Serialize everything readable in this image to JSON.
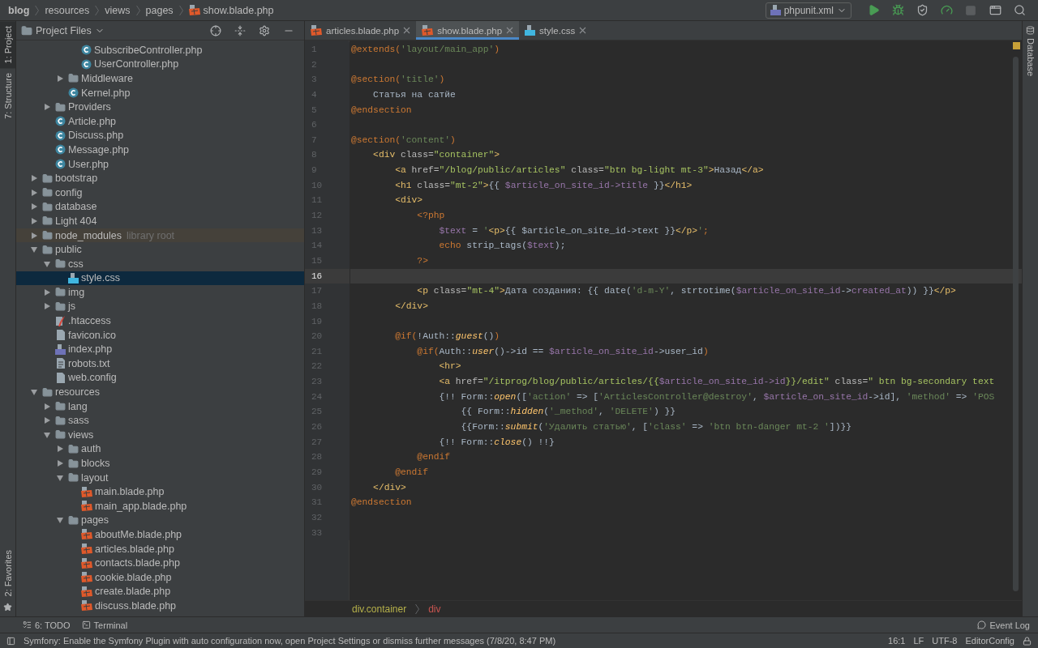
{
  "nav_bar": {
    "breadcrumbs": [
      "blog",
      "resources",
      "views",
      "pages",
      "show.blade.php"
    ],
    "run_config": {
      "label": "phpunit.xml"
    }
  },
  "left_tool_strip": [
    {
      "label": "1: Project",
      "selected": true
    },
    {
      "label": "7: Structure",
      "selected": false
    }
  ],
  "favorites": {
    "label": "2: Favorites"
  },
  "project_panel": {
    "title": "Project Files",
    "items": [
      {
        "kind": "offscreen",
        "children": [
          {
            "kind": "offscreen",
            "children": [
              {
                "kind": "offscreen",
                "children": [
                  {
                    "kind": "class",
                    "label": "SubscribeController.php",
                    "selected": false
                  },
                  {
                    "kind": "class",
                    "label": "UserController.php",
                    "selected": false
                  }
                ]
              },
              {
                "kind": "folder",
                "label": "Middleware",
                "expanded": false,
                "selected": false
              },
              {
                "kind": "class",
                "label": "Kernel.php",
                "selected": false
              }
            ]
          },
          {
            "kind": "folder",
            "label": "Providers",
            "expanded": false,
            "selected": false
          },
          {
            "kind": "class",
            "label": "Article.php",
            "selected": false
          },
          {
            "kind": "class",
            "label": "Discuss.php",
            "selected": false
          },
          {
            "kind": "class",
            "label": "Message.php",
            "selected": false
          },
          {
            "kind": "class",
            "label": "User.php",
            "selected": false
          }
        ]
      },
      {
        "kind": "folder",
        "label": "bootstrap",
        "expanded": false,
        "selected": false
      },
      {
        "kind": "folder",
        "label": "config",
        "expanded": false,
        "selected": false
      },
      {
        "kind": "folder",
        "label": "database",
        "expanded": false,
        "selected": false
      },
      {
        "kind": "folder",
        "label": "Light 404",
        "expanded": false,
        "selected": false
      },
      {
        "kind": "folder",
        "label": "node_modules",
        "note": "library root",
        "expanded": false,
        "selected": false
      },
      {
        "kind": "folder",
        "label": "public",
        "expanded": true,
        "selected": false,
        "children": [
          {
            "kind": "folder",
            "label": "css",
            "expanded": true,
            "selected": false,
            "children": [
              {
                "kind": "css",
                "label": "style.css",
                "selected": true
              }
            ]
          },
          {
            "kind": "folder",
            "label": "img",
            "expanded": false,
            "selected": false
          },
          {
            "kind": "folder",
            "label": "js",
            "expanded": false,
            "selected": false
          },
          {
            "kind": "htaccess",
            "label": ".htaccess",
            "selected": false
          },
          {
            "kind": "generic",
            "label": "favicon.ico",
            "selected": false
          },
          {
            "kind": "php",
            "label": "index.php",
            "selected": false
          },
          {
            "kind": "text",
            "label": "robots.txt",
            "selected": false
          },
          {
            "kind": "generic",
            "label": "web.config",
            "selected": false
          }
        ]
      },
      {
        "kind": "folder",
        "label": "resources",
        "expanded": true,
        "selected": false,
        "children": [
          {
            "kind": "folder",
            "label": "lang",
            "expanded": false,
            "selected": false
          },
          {
            "kind": "folder",
            "label": "sass",
            "expanded": false,
            "selected": false
          },
          {
            "kind": "folder",
            "label": "views",
            "expanded": true,
            "selected": false,
            "children": [
              {
                "kind": "folder",
                "label": "auth",
                "expanded": false,
                "selected": false
              },
              {
                "kind": "folder",
                "label": "blocks",
                "expanded": false,
                "selected": false
              },
              {
                "kind": "folder",
                "label": "layout",
                "expanded": true,
                "selected": false,
                "children": [
                  {
                    "kind": "blade",
                    "label": "main.blade.php",
                    "selected": false
                  },
                  {
                    "kind": "blade",
                    "label": "main_app.blade.php",
                    "selected": false
                  }
                ]
              },
              {
                "kind": "folder",
                "label": "pages",
                "expanded": true,
                "selected": false,
                "children": [
                  {
                    "kind": "blade",
                    "label": "aboutMe.blade.php",
                    "selected": false
                  },
                  {
                    "kind": "blade",
                    "label": "articles.blade.php",
                    "selected": false
                  },
                  {
                    "kind": "blade",
                    "label": "contacts.blade.php",
                    "selected": false
                  },
                  {
                    "kind": "blade",
                    "label": "cookie.blade.php",
                    "selected": false
                  },
                  {
                    "kind": "blade",
                    "label": "create.blade.php",
                    "selected": false
                  },
                  {
                    "kind": "blade",
                    "label": "discuss.blade.php",
                    "selected": false
                  }
                ]
              }
            ]
          }
        ]
      }
    ]
  },
  "tabs": [
    {
      "label": "articles.blade.php",
      "kind": "blade",
      "selected": false
    },
    {
      "label": "show.blade.php",
      "kind": "blade",
      "selected": true
    },
    {
      "label": "style.css",
      "kind": "css",
      "selected": false
    }
  ],
  "editor": {
    "lines": [
      {
        "number": "1",
        "current": false,
        "tokens": [
          {
            "kind": "directive",
            "text": "@extends("
          },
          {
            "kind": "string",
            "text": "'layout/main_app'"
          },
          {
            "kind": "directive",
            "text": ")"
          }
        ]
      },
      {
        "number": "2",
        "current": false
      },
      {
        "number": "3",
        "current": false,
        "tokens": [
          {
            "kind": "directive",
            "text": "@section("
          },
          {
            "kind": "string",
            "text": "'title'"
          },
          {
            "kind": "directive",
            "text": ")"
          }
        ]
      },
      {
        "number": "4",
        "current": false,
        "tokens": [
          {
            "kind": "plain",
            "text": "    Статья на сатйе"
          }
        ]
      },
      {
        "number": "5",
        "current": false,
        "tokens": [
          {
            "kind": "directive",
            "text": "@endsection"
          }
        ]
      },
      {
        "number": "6",
        "current": false
      },
      {
        "number": "7",
        "current": false,
        "tokens": [
          {
            "kind": "directive",
            "text": "@section("
          },
          {
            "kind": "string",
            "text": "'content'"
          },
          {
            "kind": "directive",
            "text": ")"
          }
        ]
      },
      {
        "number": "8",
        "current": false,
        "tokens": [
          {
            "kind": "tag",
            "text": "    <div"
          },
          {
            "kind": "attr",
            "text": " class="
          },
          {
            "kind": "value",
            "text": "\"container\""
          },
          {
            "kind": "tag",
            "text": ">"
          }
        ]
      },
      {
        "number": "9",
        "current": false,
        "tokens": [
          {
            "kind": "tag",
            "text": "        <a"
          },
          {
            "kind": "attr",
            "text": " href="
          },
          {
            "kind": "value",
            "text": "\"/blog/public/articles\""
          },
          {
            "kind": "attr",
            "text": " class="
          },
          {
            "kind": "value",
            "text": "\"btn bg-light mt-3\""
          },
          {
            "kind": "tag",
            "text": ">"
          },
          {
            "kind": "plain",
            "text": "Назад"
          },
          {
            "kind": "tag",
            "text": "</a>"
          }
        ]
      },
      {
        "number": "10",
        "current": false,
        "tokens": [
          {
            "kind": "tag",
            "text": "        <h1"
          },
          {
            "kind": "attr",
            "text": " class="
          },
          {
            "kind": "value",
            "text": "\"mt-2\""
          },
          {
            "kind": "tag",
            "text": ">"
          },
          {
            "kind": "plain",
            "text": "{{ "
          },
          {
            "kind": "var",
            "text": "$article_on_site_id->title"
          },
          {
            "kind": "plain",
            "text": " }}"
          },
          {
            "kind": "tag",
            "text": "</h1>"
          }
        ]
      },
      {
        "number": "11",
        "current": false,
        "tokens": [
          {
            "kind": "tag",
            "text": "        <div>"
          }
        ]
      },
      {
        "number": "12",
        "current": false,
        "tokens": [
          {
            "kind": "keyword",
            "text": "            <?php"
          }
        ]
      },
      {
        "number": "13",
        "current": false,
        "tokens": [
          {
            "kind": "var",
            "text": "                $text"
          },
          {
            "kind": "plain",
            "text": " = "
          },
          {
            "kind": "string",
            "text": "'"
          },
          {
            "kind": "tag",
            "text": "<p>"
          },
          {
            "kind": "plain",
            "text": "{{ $article_on_site_id->text }}"
          },
          {
            "kind": "tag",
            "text": "</p>"
          },
          {
            "kind": "string",
            "text": "'"
          },
          {
            "kind": "keyword",
            "text": ";"
          }
        ]
      },
      {
        "number": "14",
        "current": false,
        "tokens": [
          {
            "kind": "keyword",
            "text": "                echo"
          },
          {
            "kind": "plain",
            "text": " strip_tags("
          },
          {
            "kind": "var",
            "text": "$text"
          },
          {
            "kind": "plain",
            "text": ");"
          }
        ]
      },
      {
        "number": "15",
        "current": false,
        "tokens": [
          {
            "kind": "keyword",
            "text": "            ?>"
          }
        ]
      },
      {
        "number": "16",
        "current": true
      },
      {
        "number": "17",
        "current": false,
        "tokens": [
          {
            "kind": "tag",
            "text": "            <p"
          },
          {
            "kind": "attr",
            "text": " class="
          },
          {
            "kind": "value",
            "text": "\"mt-4\""
          },
          {
            "kind": "tag",
            "text": ">"
          },
          {
            "kind": "plain",
            "text": "Дата создания: {{ date("
          },
          {
            "kind": "string",
            "text": "'d-m-Y'"
          },
          {
            "kind": "plain",
            "text": ", strtotime("
          },
          {
            "kind": "var",
            "text": "$article_on_site_id"
          },
          {
            "kind": "plain",
            "text": "->"
          },
          {
            "kind": "var",
            "text": "created_at"
          },
          {
            "kind": "plain",
            "text": ")) }}"
          },
          {
            "kind": "tag",
            "text": "</p>"
          }
        ]
      },
      {
        "number": "18",
        "current": false,
        "tokens": [
          {
            "kind": "tag",
            "text": "        </div>"
          }
        ]
      },
      {
        "number": "19",
        "current": false
      },
      {
        "number": "20",
        "current": false,
        "tokens": [
          {
            "kind": "directive",
            "text": "        @if("
          },
          {
            "kind": "plain",
            "text": "!Auth::"
          },
          {
            "kind": "call",
            "text": "guest"
          },
          {
            "kind": "plain",
            "text": "()"
          },
          {
            "kind": "directive",
            "text": ")"
          }
        ]
      },
      {
        "number": "21",
        "current": false,
        "tokens": [
          {
            "kind": "directive",
            "text": "            @if("
          },
          {
            "kind": "plain",
            "text": "Auth::"
          },
          {
            "kind": "call",
            "text": "user"
          },
          {
            "kind": "plain",
            "text": "()->id == "
          },
          {
            "kind": "var",
            "text": "$article_on_site_id"
          },
          {
            "kind": "plain",
            "text": "->user_id"
          },
          {
            "kind": "directive",
            "text": ")"
          }
        ]
      },
      {
        "number": "22",
        "current": false,
        "tokens": [
          {
            "kind": "tag",
            "text": "                <hr>"
          }
        ]
      },
      {
        "number": "23",
        "current": false,
        "tokens": [
          {
            "kind": "tag",
            "text": "                <a"
          },
          {
            "kind": "attr",
            "text": " href="
          },
          {
            "kind": "value",
            "text": "\"/itprog/blog/public/articles/{{"
          },
          {
            "kind": "var",
            "text": "$article_on_site_id->id"
          },
          {
            "kind": "value",
            "text": "}}/edit\""
          },
          {
            "kind": "attr",
            "text": " class="
          },
          {
            "kind": "value",
            "text": "\" btn bg-secondary text"
          }
        ]
      },
      {
        "number": "24",
        "current": false,
        "tokens": [
          {
            "kind": "plain",
            "text": "                {!! Form::"
          },
          {
            "kind": "call",
            "text": "open"
          },
          {
            "kind": "plain",
            "text": "(["
          },
          {
            "kind": "string",
            "text": "'action'"
          },
          {
            "kind": "plain",
            "text": " => ["
          },
          {
            "kind": "string",
            "text": "'ArticlesController@destroy'"
          },
          {
            "kind": "plain",
            "text": ", "
          },
          {
            "kind": "var",
            "text": "$article_on_site_id"
          },
          {
            "kind": "plain",
            "text": "->id], "
          },
          {
            "kind": "string",
            "text": "'method'"
          },
          {
            "kind": "plain",
            "text": " => "
          },
          {
            "kind": "string",
            "text": "'POS"
          }
        ]
      },
      {
        "number": "25",
        "current": false,
        "tokens": [
          {
            "kind": "plain",
            "text": "                    {{ Form::"
          },
          {
            "kind": "call",
            "text": "hidden"
          },
          {
            "kind": "plain",
            "text": "("
          },
          {
            "kind": "string",
            "text": "'_method'"
          },
          {
            "kind": "plain",
            "text": ", "
          },
          {
            "kind": "string",
            "text": "'DELETE'"
          },
          {
            "kind": "plain",
            "text": ") }}"
          }
        ]
      },
      {
        "number": "26",
        "current": false,
        "tokens": [
          {
            "kind": "plain",
            "text": "                    {{Form::"
          },
          {
            "kind": "call",
            "text": "submit"
          },
          {
            "kind": "plain",
            "text": "("
          },
          {
            "kind": "string",
            "text": "'Удалить статью'"
          },
          {
            "kind": "plain",
            "text": ", ["
          },
          {
            "kind": "string",
            "text": "'class'"
          },
          {
            "kind": "plain",
            "text": " => "
          },
          {
            "kind": "string",
            "text": "'btn btn-danger mt-2 '"
          },
          {
            "kind": "plain",
            "text": "])}}"
          }
        ]
      },
      {
        "number": "27",
        "current": false,
        "tokens": [
          {
            "kind": "plain",
            "text": "                {!! Form::"
          },
          {
            "kind": "call",
            "text": "close"
          },
          {
            "kind": "plain",
            "text": "() !!}"
          }
        ]
      },
      {
        "number": "28",
        "current": false,
        "tokens": [
          {
            "kind": "directive",
            "text": "            @endif"
          }
        ]
      },
      {
        "number": "29",
        "current": false,
        "tokens": [
          {
            "kind": "directive",
            "text": "        @endif"
          }
        ]
      },
      {
        "number": "30",
        "current": false,
        "tokens": [
          {
            "kind": "tag",
            "text": "    </div>"
          }
        ]
      },
      {
        "number": "31",
        "current": false,
        "tokens": [
          {
            "kind": "directive",
            "text": "@endsection"
          }
        ]
      },
      {
        "number": "32",
        "current": false
      },
      {
        "number": "33",
        "current": false
      }
    ],
    "breadcrumbs": [
      "div.container",
      "div"
    ]
  },
  "right_tool_strip": [
    {
      "label": "Database"
    }
  ],
  "bottom_tools": [
    {
      "label": "6: TODO"
    },
    {
      "label": "Terminal"
    }
  ],
  "event_log": {
    "label": "Event Log"
  },
  "status_bar": {
    "message": "Symfony: Enable the Symfony Plugin with auto configuration now, open Project Settings or dismiss further messages (7/8/20, 8:47 PM)",
    "items": [
      "16:1",
      "LF",
      "UTF-8",
      "EditorConfig"
    ]
  }
}
